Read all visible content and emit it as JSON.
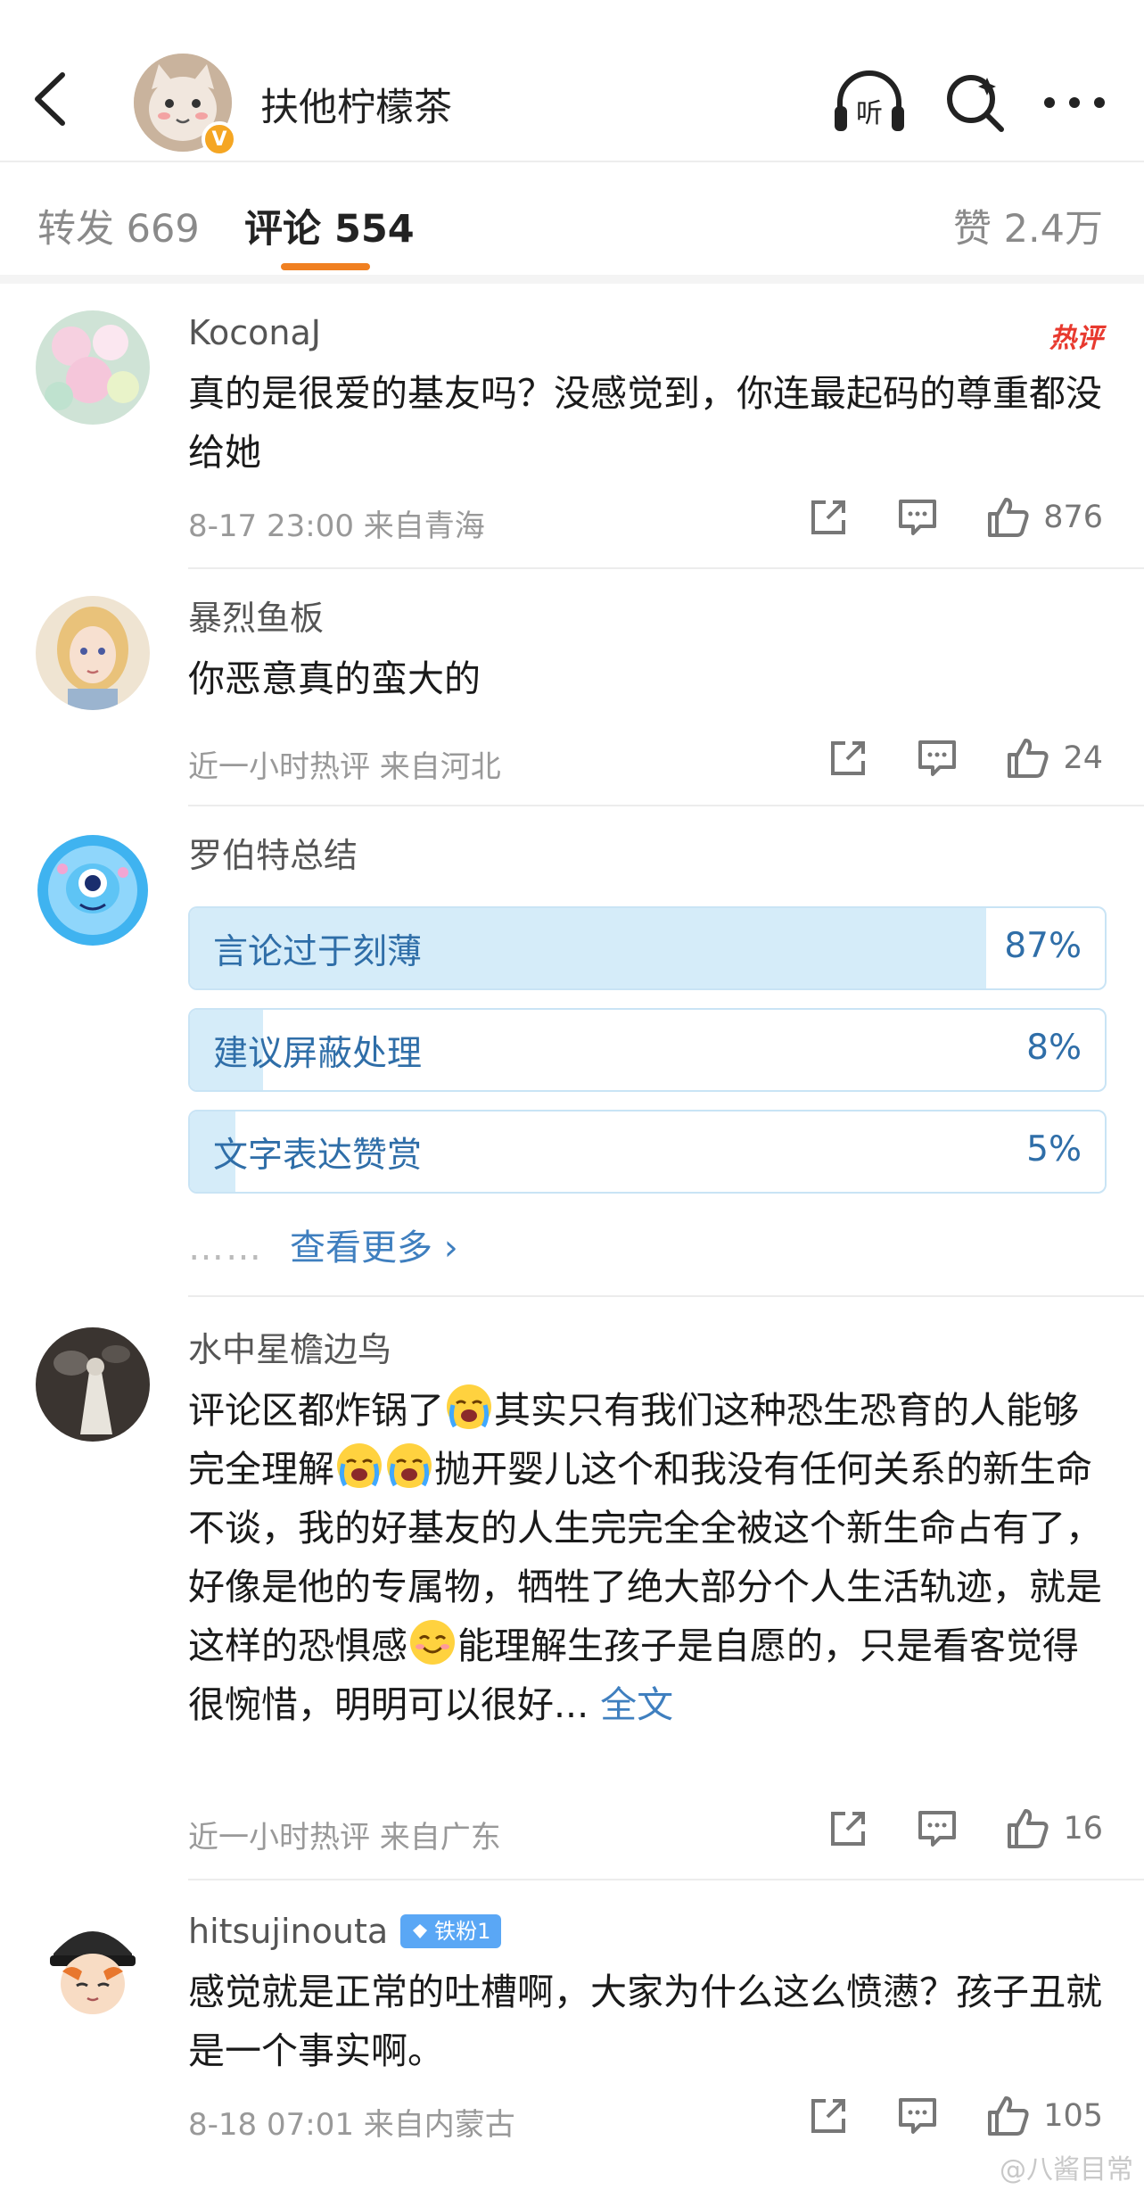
{
  "header": {
    "account_name": "扶他柠檬茶",
    "verified_badge": "V",
    "icons": [
      "back-icon",
      "headphone-listen-icon",
      "search-icon",
      "more-icon"
    ],
    "listen_label": "听"
  },
  "tabs": {
    "repost": "转发 669",
    "comments": "评论 554",
    "likes": "赞 2.4万"
  },
  "comments": [
    {
      "user": "KoconaJ",
      "hot_tag": "热评",
      "text": "真的是很爱的基友吗？没感觉到，你连最起码的尊重都没给她",
      "meta": "8-17 23:00 来自青海",
      "like_count": "876"
    },
    {
      "user": "暴烈鱼板",
      "text": "你恶意真的蛮大的",
      "meta": "近一小时热评 来自河北",
      "like_count": "24"
    },
    {
      "user": "罗伯特总结",
      "poll": [
        {
          "label": "言论过于刻薄",
          "pct": "87%",
          "value": 0.87
        },
        {
          "label": "建议屏蔽处理",
          "pct": "8%",
          "value": 0.08
        },
        {
          "label": "文字表达赞赏",
          "pct": "5%",
          "value": 0.05
        }
      ],
      "more_dots": "……",
      "more_label": "查看更多 ›"
    },
    {
      "user": "水中星檐边鸟",
      "text_parts": [
        "评论区都炸锅了",
        "其实只有我们这种恐生恐育的人能够完全理解",
        "抛开婴儿这个和我没有任何关系的新生命不谈，我的好基友的人生完完全全被这个新生命占有了，好像是他的专属物，牺牲了绝大部分个人生活轨迹，就是这样的恐惧感",
        "能理解生孩子是自愿的，只是看客觉得很惋惜，明明可以很好...",
        "全文"
      ],
      "meta": "近一小时热评 来自广东",
      "like_count": "16"
    },
    {
      "user": "hitsujinouta",
      "fan_badge": "铁粉1",
      "text": "感觉就是正常的吐槽啊，大家为什么这么愤懑？孩子丑就是一个事实啊。",
      "meta": "8-18 07:01 来自内蒙古",
      "like_count": "105"
    }
  ],
  "watermark": "@八酱目常",
  "colors": {
    "accent": "#f08021",
    "link": "#3f7fbf",
    "hot": "#e83a2f",
    "poll_fill": "#d5ecf9"
  }
}
